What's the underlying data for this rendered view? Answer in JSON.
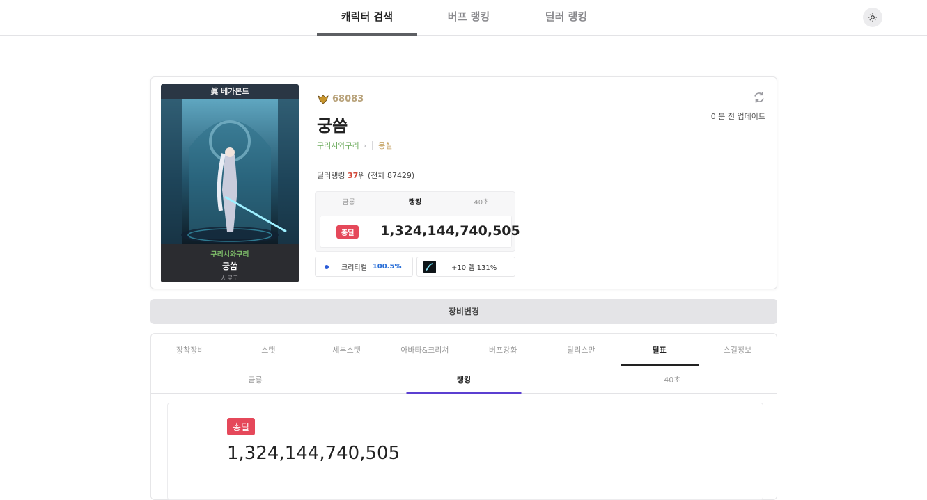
{
  "nav": {
    "tabs": [
      "캐릭터 검색",
      "버프 랭킹",
      "딜러 랭킹"
    ]
  },
  "theme_icon": "sun-icon",
  "profile": {
    "banner": "眞 베가본드",
    "fame": "68083",
    "name": "궁씀",
    "guild": "구리시와구리",
    "server": "몽실",
    "rank_prefix": "딜러랭킹 ",
    "rank": "37",
    "rank_suffix": "위 (전체 87429)",
    "updated": "0 분 전 업데이트",
    "image_guild": "구리시와구리",
    "image_name": "궁씀",
    "image_job": "시로코"
  },
  "mini": {
    "tabs": [
      "금룡",
      "랭킹",
      "40초"
    ],
    "active_tab": 1,
    "badge": "총딜",
    "value": "1,324,144,740,505"
  },
  "chips": {
    "crit_label": "크리티컬",
    "crit_pct": "100.5%",
    "weapon_label": "+10 렙 131%"
  },
  "equip_change": "장비변경",
  "main_tabs": [
    "장착장비",
    "스탯",
    "세부스탯",
    "아바타&크리쳐",
    "버프강화",
    "탈리스만",
    "딜표",
    "스킬정보"
  ],
  "main_active_tab": 6,
  "sub_tabs": [
    "금룡",
    "랭킹",
    "40초"
  ],
  "sub_active_tab": 1,
  "result": {
    "badge": "총딜",
    "value": "1,324,144,740,505"
  },
  "colors": {
    "badge_red": "#e5485a",
    "crit_blue": "#2a6fd7",
    "rank_red": "#d2493a",
    "sub_tab_underline": "#5b3fd1"
  }
}
